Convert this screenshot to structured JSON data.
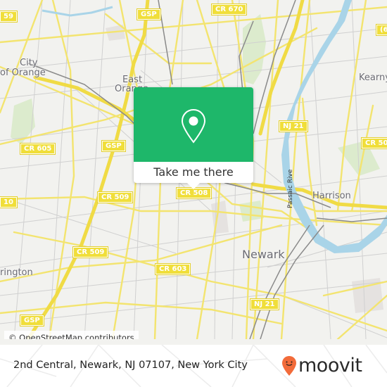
{
  "map": {
    "place_labels": [
      {
        "id": "city-of-orange-1",
        "text": "City",
        "size": "mid"
      },
      {
        "id": "city-of-orange-2",
        "text": "of Orange",
        "size": "mid"
      },
      {
        "id": "east-orange-1",
        "text": "East",
        "size": "mid"
      },
      {
        "id": "east-orange-2",
        "text": "Orange",
        "size": "mid"
      },
      {
        "id": "kearny",
        "text": "Kearny",
        "size": "mid"
      },
      {
        "id": "harrison",
        "text": "Harrison",
        "size": "mid"
      },
      {
        "id": "newark",
        "text": "Newark",
        "size": "big"
      },
      {
        "id": "irvington",
        "text": "rington",
        "size": "mid"
      }
    ],
    "road_shields": [
      {
        "id": "gsp-north",
        "text": "GSP"
      },
      {
        "id": "cr-670",
        "text": "CR 670"
      },
      {
        "id": "cr-59-edge",
        "text": "59"
      },
      {
        "id": "cr-605",
        "text": "CR 605"
      },
      {
        "id": "gsp-mid",
        "text": "GSP"
      },
      {
        "id": "nj-21-north",
        "text": "NJ 21"
      },
      {
        "id": "cr-508-right",
        "text": "CR 50"
      },
      {
        "id": "cr-6-right",
        "text": "(6"
      },
      {
        "id": "cr-10-edge",
        "text": "10"
      },
      {
        "id": "cr-509-a",
        "text": "CR 509"
      },
      {
        "id": "cr-508",
        "text": "CR 508"
      },
      {
        "id": "cr-509-b",
        "text": "CR 509"
      },
      {
        "id": "cr-603",
        "text": "CR 603"
      },
      {
        "id": "nj-21-south",
        "text": "NJ 21"
      },
      {
        "id": "gsp-south",
        "text": "GSP"
      }
    ],
    "river_label": "Passaic Rive",
    "attribution": "© OpenStreetMap contributors"
  },
  "popup": {
    "icon": "map-pin-icon",
    "button_label": "Take me there",
    "accent_color": "#1eb76a"
  },
  "footer": {
    "address": "2nd Central, Newark, NJ 07107, New York City",
    "logo_text": "moovit",
    "logo_icon": "moovit-pin-icon",
    "logo_color": "#f26b3a"
  }
}
